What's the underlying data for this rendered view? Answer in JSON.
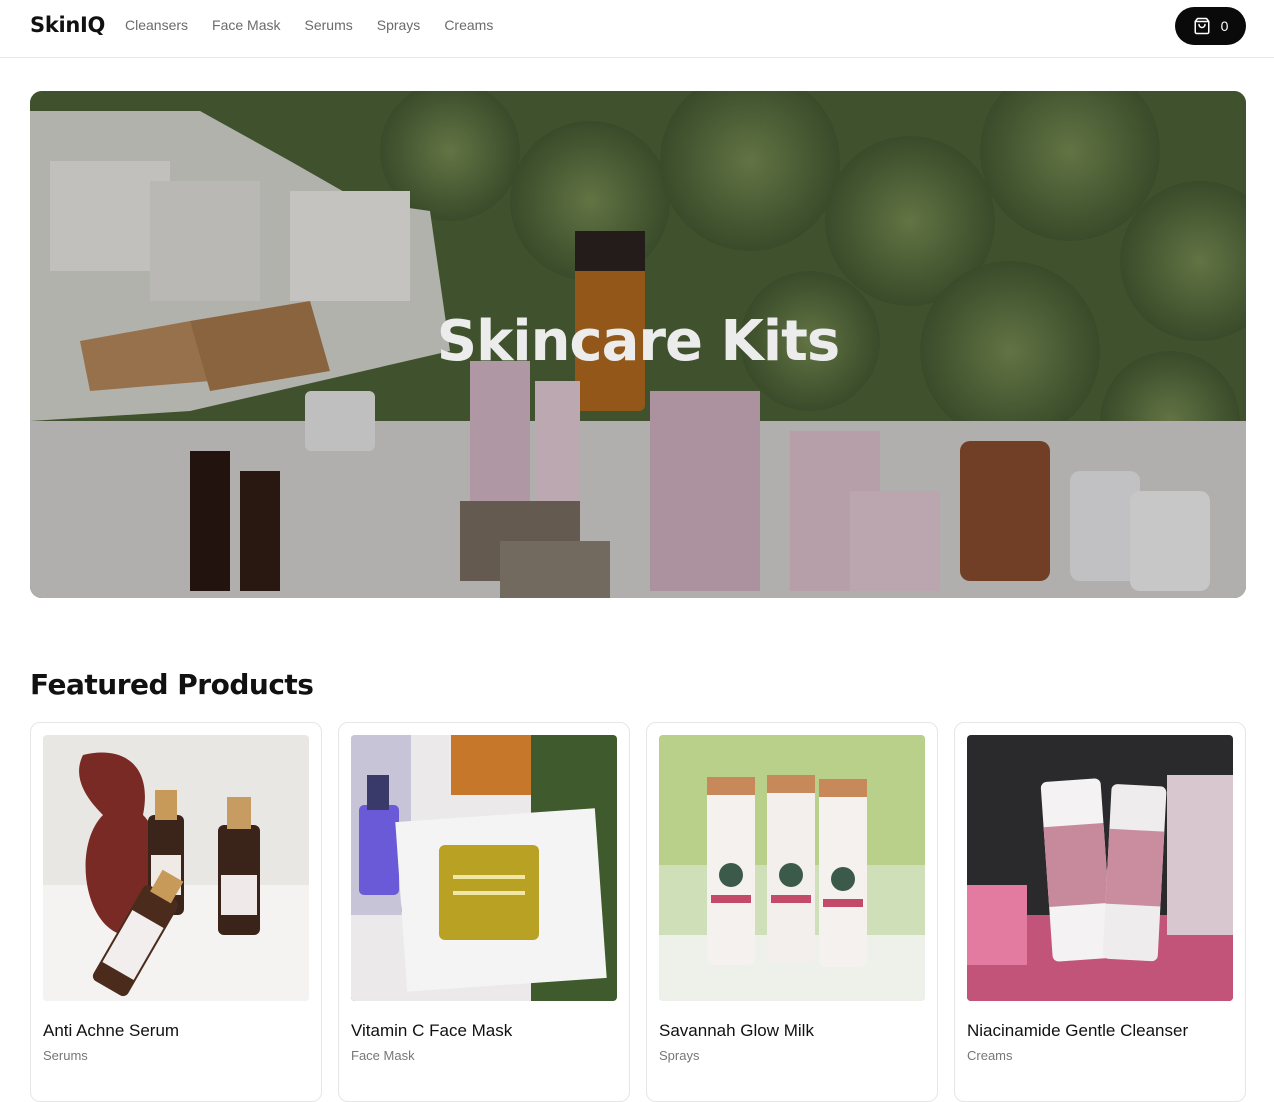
{
  "header": {
    "logo": "SkinIQ",
    "nav": [
      "Cleansers",
      "Face Mask",
      "Serums",
      "Sprays",
      "Creams"
    ],
    "cart_count": "0"
  },
  "hero": {
    "title": "Skincare Kits"
  },
  "featured": {
    "title": "Featured Products",
    "products": [
      {
        "name": "Anti Achne Serum",
        "category": "Serums"
      },
      {
        "name": "Vitamin C Face Mask",
        "category": "Face Mask"
      },
      {
        "name": "Savannah Glow Milk",
        "category": "Sprays"
      },
      {
        "name": "Niacinamide Gentle Cleanser",
        "category": "Creams"
      }
    ]
  },
  "colors": {
    "accent": "#0a0a0a",
    "muted_text": "#777777",
    "border": "#e6e6e6"
  }
}
